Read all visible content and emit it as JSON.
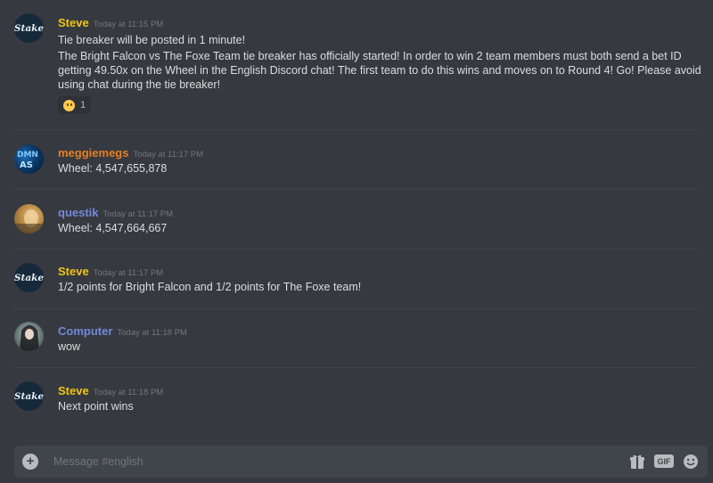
{
  "channel": {
    "composer_placeholder": "Message #english"
  },
  "messages": [
    {
      "author": "Steve",
      "author_color": "#f1c40f",
      "timestamp": "Today at 11:15 PM",
      "lines": [
        "Tie breaker will be posted in 1 minute!",
        "The Bright Falcon vs The Foxe Team tie breaker has officially started! In order to win 2 team members must both send a bet ID getting 49.50x on the Wheel in the English Discord chat! The first team to do this wins and moves on to Round 4! Go! Please avoid using chat during the tie breaker!"
      ],
      "reaction": {
        "emoji": "slightly-smiling-face",
        "count": "1"
      }
    },
    {
      "author": "meggiemegs",
      "author_color": "#e67e22",
      "timestamp": "Today at 11:17 PM",
      "lines": [
        "Wheel: 4,547,655,878"
      ]
    },
    {
      "author": "questik",
      "author_color": "#7289da",
      "timestamp": "Today at 11:17 PM",
      "lines": [
        "Wheel: 4,547,664,667"
      ]
    },
    {
      "author": "Steve",
      "author_color": "#f1c40f",
      "timestamp": "Today at 11:17 PM",
      "lines": [
        "1/2 points for Bright Falcon and 1/2 points for The Foxe team!"
      ]
    },
    {
      "author": "Computer",
      "author_color": "#7289da",
      "timestamp": "Today at 11:18 PM",
      "lines": [
        "wow"
      ]
    },
    {
      "author": "Steve",
      "author_color": "#f1c40f",
      "timestamp": "Today at 11:18 PM",
      "lines": [
        "Next point wins"
      ]
    }
  ],
  "avatars": {
    "stake_text": "Stake"
  },
  "icons": {
    "add": "plus-circle-icon",
    "gift": "gift-icon",
    "gif": "GIF",
    "emoji": "emoji-picker-icon"
  }
}
